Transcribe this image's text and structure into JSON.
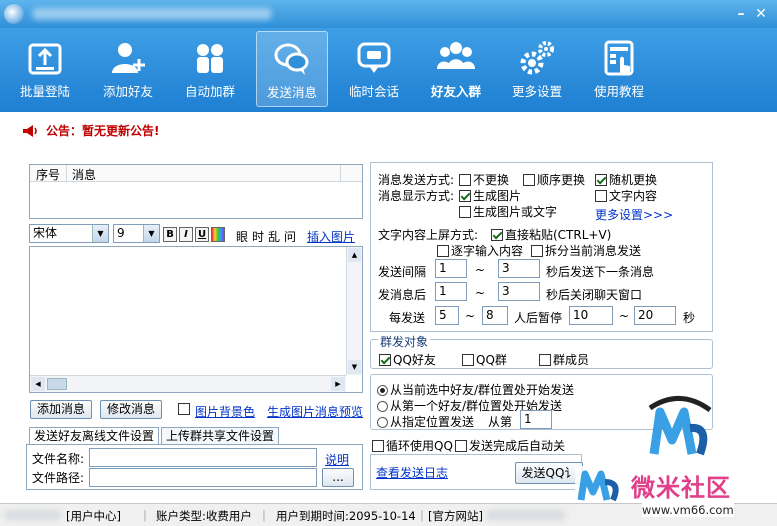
{
  "toolbar": {
    "items": [
      {
        "id": "batch-login",
        "label": "批量登陆",
        "icon": "upload-box-icon"
      },
      {
        "id": "add-friend",
        "label": "添加好友",
        "icon": "add-user-icon"
      },
      {
        "id": "auto-join",
        "label": "自动加群",
        "icon": "group-icon"
      },
      {
        "id": "send-msg",
        "label": "发送消息",
        "icon": "chat-bubbles-icon"
      },
      {
        "id": "temp-chat",
        "label": "临时会话",
        "icon": "chat-bubble-icon"
      },
      {
        "id": "friend-join",
        "label": "好友入群",
        "icon": "people-icon"
      },
      {
        "id": "more-settings",
        "label": "更多设置",
        "icon": "gears-icon"
      },
      {
        "id": "tutorial",
        "label": "使用教程",
        "icon": "tablet-hand-icon"
      }
    ]
  },
  "notice": {
    "text": "公告：暂无更新公告!"
  },
  "message_table": {
    "col_index": "序号",
    "col_message": "消息"
  },
  "editor": {
    "font": "宋体",
    "size": "9",
    "fmt_bold": "B",
    "fmt_italic": "I",
    "fmt_underline": "U",
    "btn_time": "眼",
    "btn_sec": "时",
    "btn_rand": "乱",
    "btn_ask": "问",
    "insert_image": "插入图片"
  },
  "actions": {
    "add_message": "添加消息",
    "edit_message": "修改消息",
    "image_bg": "图片背景色",
    "gen_preview": "生成图片消息预览"
  },
  "file_tabs": {
    "tab1": "发送好友离线文件设置",
    "tab2": "上传群共享文件设置",
    "file_name_label": "文件名称:",
    "file_path_label": "文件路径:",
    "help": "说明",
    "browse": "..."
  },
  "settings": {
    "send_mode_label": "消息发送方式:",
    "no_change": "不更换",
    "seq_change": "顺序更换",
    "rand_change": "随机更换",
    "display_label": "消息显示方式:",
    "gen_image": "生成图片",
    "text_content": "文字内容",
    "gen_image_or_text": "生成图片或文字",
    "more": "更多设置>>>",
    "screen_label": "文字内容上屏方式:",
    "direct_paste": "直接粘贴(CTRL+V)",
    "char_input": "逐字输入内容",
    "split_send": "拆分当前消息发送",
    "interval_label": "发送间隔",
    "interval_from": "1",
    "interval_to": "3",
    "interval_suffix": "秒后发送下一条消息",
    "after_label": "发消息后",
    "after_from": "1",
    "after_to": "3",
    "after_suffix": "秒后关闭聊天窗口",
    "every_label": "每发送",
    "every_from": "5",
    "every_to": "8",
    "pause_label": "人后暂停",
    "pause_from": "10",
    "pause_to": "20",
    "pause_unit": "秒",
    "tilde": "~"
  },
  "targets": {
    "title": "群发对象",
    "qq_friend": "QQ好友",
    "qq_group": "QQ群",
    "group_member": "群成员"
  },
  "start": {
    "opt1": "从当前选中好友/群位置处开始发送",
    "opt2": "从第一个好友/群位置处开始发送",
    "opt3": "从指定位置发送",
    "from_label": "从第",
    "from_value": "1",
    "loop": "循环使用QQ",
    "auto_close": "发送完成后自动关",
    "log": "查看发送日志",
    "send_btn": "发送QQ讠"
  },
  "status": {
    "user_center": "[用户中心]",
    "account_type": "账户类型:收费用户",
    "expiry": "用户到期时间:2095-10-14",
    "website": "[官方网站]"
  },
  "watermark": {
    "brand": "微米社区",
    "url": "www.vm66.com"
  },
  "colors": {
    "toolbar": "#2a8ad8",
    "notice": "#c00000",
    "link": "#0033cc"
  }
}
